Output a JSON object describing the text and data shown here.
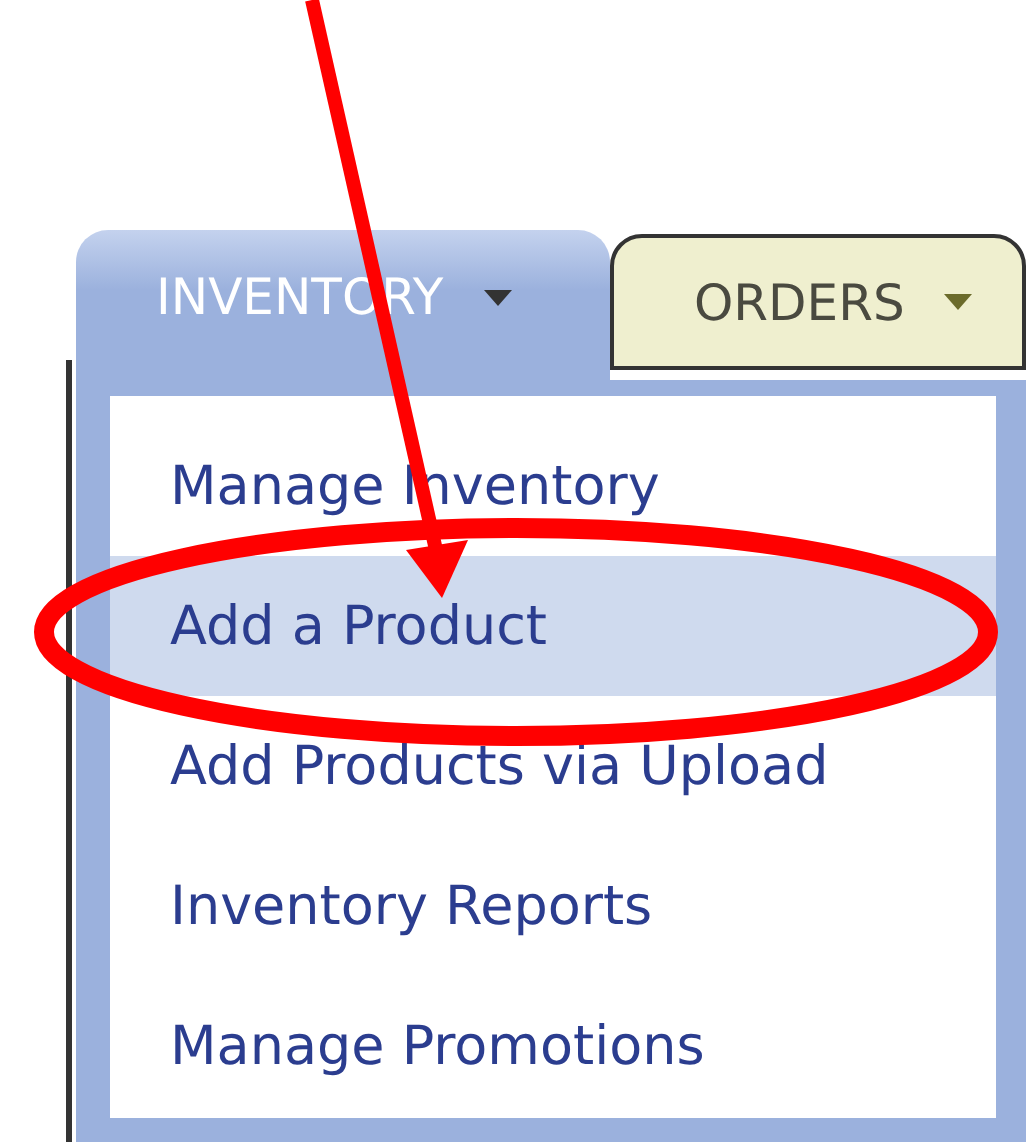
{
  "tabs": [
    {
      "label": "INVENTORY",
      "selected": true
    },
    {
      "label": "ORDERS",
      "selected": false
    }
  ],
  "menu": {
    "items": [
      {
        "label": "Manage Inventory",
        "selected": false
      },
      {
        "label": "Add a Product",
        "selected": true
      },
      {
        "label": "Add Products via Upload",
        "selected": false
      },
      {
        "label": "Inventory Reports",
        "selected": false
      },
      {
        "label": "Manage Promotions",
        "selected": false
      }
    ]
  }
}
